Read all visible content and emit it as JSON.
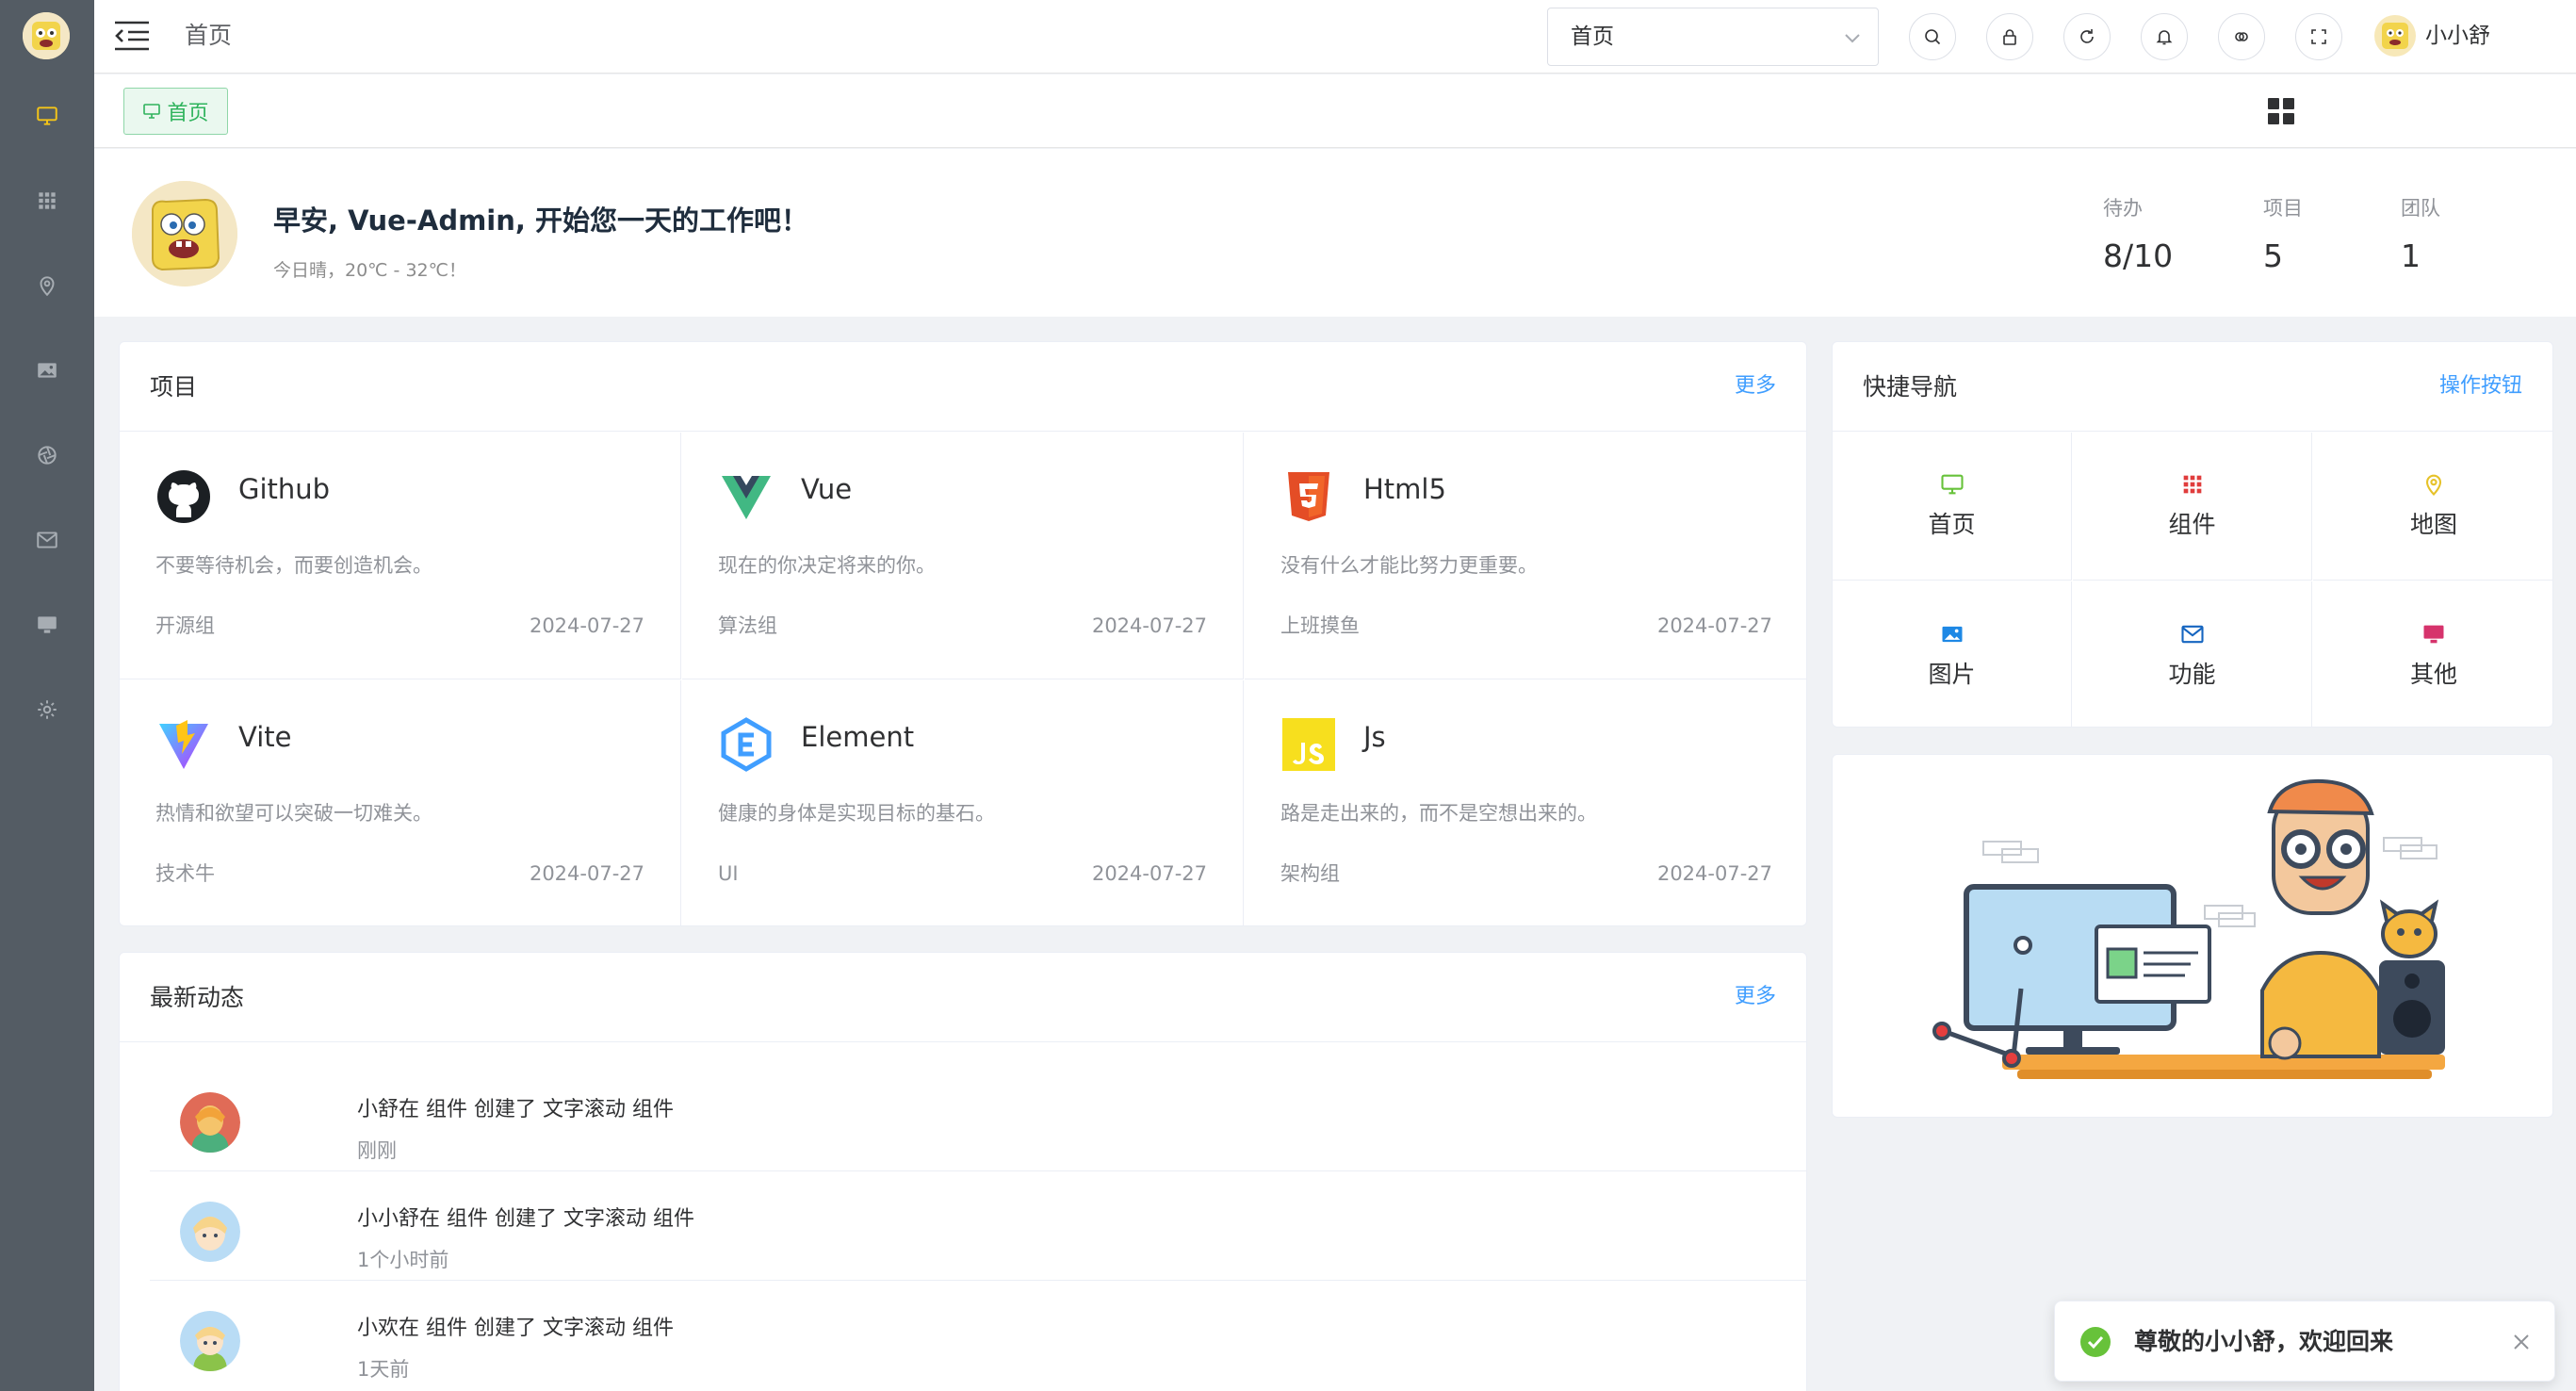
{
  "header": {
    "breadcrumb": "首页",
    "select_value": "首页",
    "user_name": "小小舒"
  },
  "tags": {
    "active": "首页"
  },
  "welcome": {
    "greeting": "早安, Vue-Admin, 开始您一天的工作吧！",
    "weather": "今日晴，20℃ - 32℃！",
    "stats": [
      {
        "label": "待办",
        "value": "8/10"
      },
      {
        "label": "项目",
        "value": "5"
      },
      {
        "label": "团队",
        "value": "1"
      }
    ]
  },
  "projects": {
    "title": "项目",
    "more": "更多",
    "items": [
      {
        "name": "Github",
        "desc": "不要等待机会，而要创造机会。",
        "group": "开源组",
        "date": "2024-07-27",
        "icon": "github-icon"
      },
      {
        "name": "Vue",
        "desc": "现在的你决定将来的你。",
        "group": "算法组",
        "date": "2024-07-27",
        "icon": "vue-icon"
      },
      {
        "name": "Html5",
        "desc": "没有什么才能比努力更重要。",
        "group": "上班摸鱼",
        "date": "2024-07-27",
        "icon": "html5-icon"
      },
      {
        "name": "Vite",
        "desc": "热情和欲望可以突破一切难关。",
        "group": "技术牛",
        "date": "2024-07-27",
        "icon": "vite-icon"
      },
      {
        "name": "Element",
        "desc": "健康的身体是实现目标的基石。",
        "group": "UI",
        "date": "2024-07-27",
        "icon": "element-icon"
      },
      {
        "name": "Js",
        "desc": "路是走出来的，而不是空想出来的。",
        "group": "架构组",
        "date": "2024-07-27",
        "icon": "js-icon"
      }
    ]
  },
  "quicknav": {
    "title": "快捷导航",
    "action": "操作按钮",
    "items": [
      {
        "label": "首页",
        "icon": "monitor-icon",
        "color": "#67c23a"
      },
      {
        "label": "组件",
        "icon": "grid-icon",
        "color": "#e03c3c"
      },
      {
        "label": "地图",
        "icon": "location-icon",
        "color": "#e6c229"
      },
      {
        "label": "图片",
        "icon": "picture-icon",
        "color": "#1e88e5"
      },
      {
        "label": "功能",
        "icon": "message-icon",
        "color": "#1565c0"
      },
      {
        "label": "其他",
        "icon": "screen-icon",
        "color": "#d6336c"
      }
    ]
  },
  "activity": {
    "title": "最新动态",
    "more": "更多",
    "items": [
      {
        "text": "小舒在 组件 创建了 文字滚动 组件",
        "time": "刚刚"
      },
      {
        "text": "小小舒在 组件 创建了 文字滚动 组件",
        "time": "1个小时前"
      },
      {
        "text": "小欢在 组件 创建了 文字滚动 组件",
        "time": "1天前"
      }
    ]
  },
  "toast": {
    "message": "尊敬的小小舒，欢迎回来"
  },
  "colors": {
    "sidebar_bg": "#545c64",
    "accent": "#409eff",
    "success": "#67c23a",
    "sidebar_active": "#f5c518"
  }
}
